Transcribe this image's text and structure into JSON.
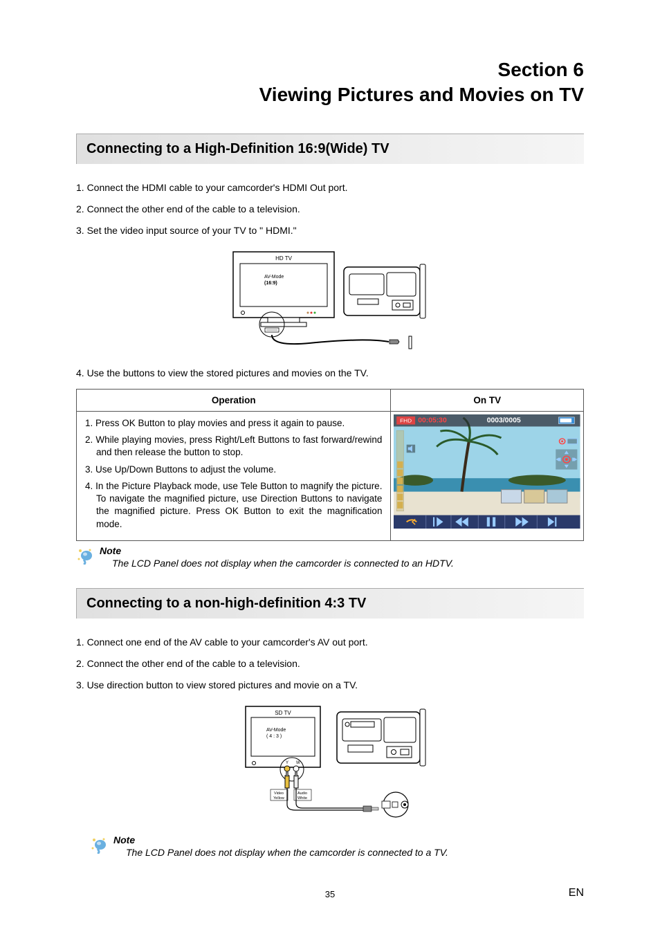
{
  "header": {
    "section_number": "Section 6",
    "section_title": "Viewing Pictures and Movies on TV"
  },
  "subsection_hd": {
    "title": "Connecting to a High-Definition 16:9(Wide) TV",
    "steps": [
      "1. Connect the HDMI cable to your camcorder's HDMI Out port.",
      "2. Connect the other end of the cable to a television.",
      "3. Set the video input source of your TV to \" HDMI.\""
    ],
    "diagram": {
      "tv_label": "HD TV",
      "mode_label_1": "AV-Mode",
      "mode_label_2": "(16:9)"
    },
    "step4": "4. Use the buttons to view the stored pictures and movies on the TV.",
    "table": {
      "col_operation": "Operation",
      "col_on_tv": "On TV",
      "ops": [
        "1. Press OK Button to play movies and press it again to pause.",
        "2. While playing movies, press Right/Left Buttons to fast forward/rewind and then release the button to stop.",
        "3. Use Up/Down Buttons to adjust the volume.",
        "4. In the Picture Playback mode, use Tele Button to magnify the picture. To navigate the magnified picture, use Direction Buttons to navigate the magnified picture. Press OK Button to exit the magnification mode."
      ],
      "tv_overlay": {
        "fhd_badge": "FHD",
        "timecode": "00:05:30",
        "counter": "0003/0005"
      }
    },
    "note": {
      "label": "Note",
      "body": "The LCD Panel does not display when the camcorder is connected to an HDTV."
    }
  },
  "subsection_sd": {
    "title": "Connecting to a non-high-definition 4:3 TV",
    "steps": [
      "1. Connect one end of the AV cable to your camcorder's AV out port.",
      "2. Connect the other end of the cable to a television.",
      "3. Use direction button to view stored pictures and movie on a TV."
    ],
    "diagram": {
      "tv_label": "SD TV",
      "mode_label_1": "AV-Mode",
      "mode_label_2": "( 4 : 3 )",
      "port_y": "Y",
      "port_w": "W",
      "video_label_1": "Video",
      "video_label_2": "Yellow",
      "audio_label_1": "Audio",
      "audio_label_2": "White"
    },
    "note": {
      "label": "Note",
      "body": "The LCD Panel does not display when the camcorder is connected to a TV."
    }
  },
  "footer": {
    "page_number": "35",
    "lang": "EN"
  }
}
